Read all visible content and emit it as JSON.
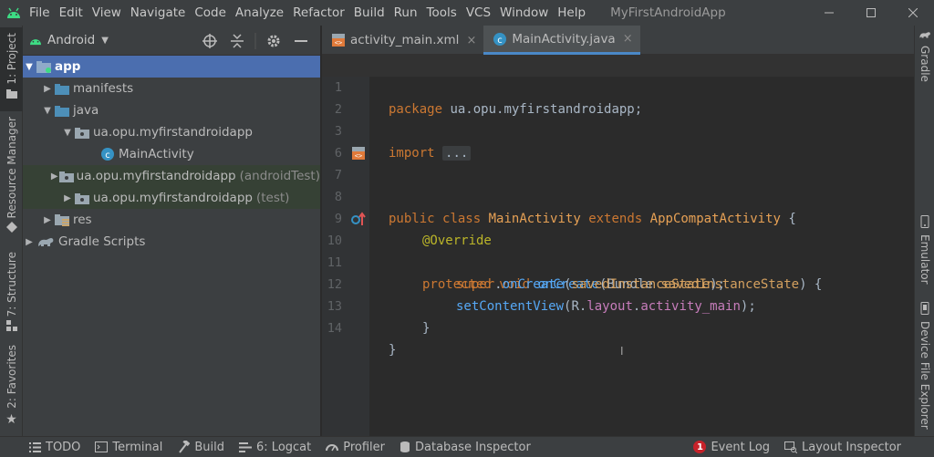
{
  "menubar": {
    "items": [
      "File",
      "Edit",
      "View",
      "Navigate",
      "Code",
      "Analyze",
      "Refactor",
      "Build",
      "Run",
      "Tools",
      "VCS",
      "Window",
      "Help"
    ],
    "window_title": "MyFirstAndroidApp",
    "icons": {
      "logo": "android-icon",
      "minimize": "minimize-icon",
      "maximize": "maximize-icon",
      "close": "close-icon"
    }
  },
  "left_strip": {
    "project": "1: Project",
    "resource_manager": "Resource Manager",
    "structure": "7: Structure",
    "favorites": "2: Favorites"
  },
  "right_strip": {
    "gradle": "Gradle",
    "emulator": "Emulator",
    "device_explorer": "Device File Explorer"
  },
  "project_panel": {
    "view_selector": "Android",
    "tree": [
      {
        "label": "app",
        "suffix": "",
        "depth": 0,
        "arrow": "down",
        "icon": "module-folder-icon"
      },
      {
        "label": "manifests",
        "suffix": "",
        "depth": 1,
        "arrow": "right",
        "icon": "folder-icon"
      },
      {
        "label": "java",
        "suffix": "",
        "depth": 1,
        "arrow": "down",
        "icon": "folder-icon"
      },
      {
        "label": "ua.opu.myfirstandroidapp",
        "suffix": "",
        "depth": 2,
        "arrow": "down",
        "icon": "package-icon"
      },
      {
        "label": "MainActivity",
        "suffix": "",
        "depth": 3,
        "arrow": "",
        "icon": "class-icon"
      },
      {
        "label": "ua.opu.myfirstandroidapp",
        "suffix": "(androidTest)",
        "depth": 2,
        "arrow": "right",
        "icon": "package-icon"
      },
      {
        "label": "ua.opu.myfirstandroidapp",
        "suffix": "(test)",
        "depth": 2,
        "arrow": "right",
        "icon": "package-icon"
      },
      {
        "label": "res",
        "suffix": "",
        "depth": 1,
        "arrow": "right",
        "icon": "res-folder-icon"
      },
      {
        "label": "Gradle Scripts",
        "suffix": "",
        "depth": 0,
        "arrow": "right",
        "icon": "gradle-icon"
      }
    ]
  },
  "editor": {
    "tabs": [
      {
        "label": "activity_main.xml",
        "close": "×"
      },
      {
        "label": "MainActivity.java",
        "close": "×"
      }
    ],
    "line_numbers": [
      "1",
      "2",
      "3",
      "6",
      "7",
      "8",
      "9",
      "10",
      "11",
      "12",
      "13",
      "14"
    ],
    "code": {
      "package_kw": "package",
      "package_name": " ua.opu.myfirstandroidapp;",
      "import_kw": "import",
      "import_fold": "...",
      "public": "public",
      "class": "class",
      "class_name": "MainActivity",
      "extends": "extends",
      "super_class": "AppCompatActivity",
      "open_brace": " {",
      "annotation": "@Override",
      "protected": "protected",
      "void": "void",
      "method": "onCreate",
      "param_type": "(Bundle",
      "param_name": "savedInstanceState",
      "param_close": ") {",
      "super_kw": "super",
      "dot": ".",
      "super_method": "onCreate",
      "super_args_open": "(",
      "super_arg": "savedInstanceState",
      "super_args_close": ");",
      "set_content": "setContentView",
      "r_open": "(R.",
      "layout": "layout",
      "r_dot": ".",
      "activity_main": "activity_main",
      "r_close": ");",
      "close_method": "}",
      "close_class": "}"
    }
  },
  "bottombar": {
    "todo": "TODO",
    "terminal": "Terminal",
    "build": "Build",
    "logcat": "6: Logcat",
    "profiler": "Profiler",
    "database": "Database Inspector",
    "event_log_count": "1",
    "event_log": "Event Log",
    "layout_inspector": "Layout Inspector"
  },
  "colors": {
    "accent": "#4b6eaf",
    "tab_underline": "#4a88c7",
    "keyword": "#cc7832",
    "annotation": "#bbb529",
    "function": "#56a8f5",
    "android_green": "#3ddc84"
  }
}
